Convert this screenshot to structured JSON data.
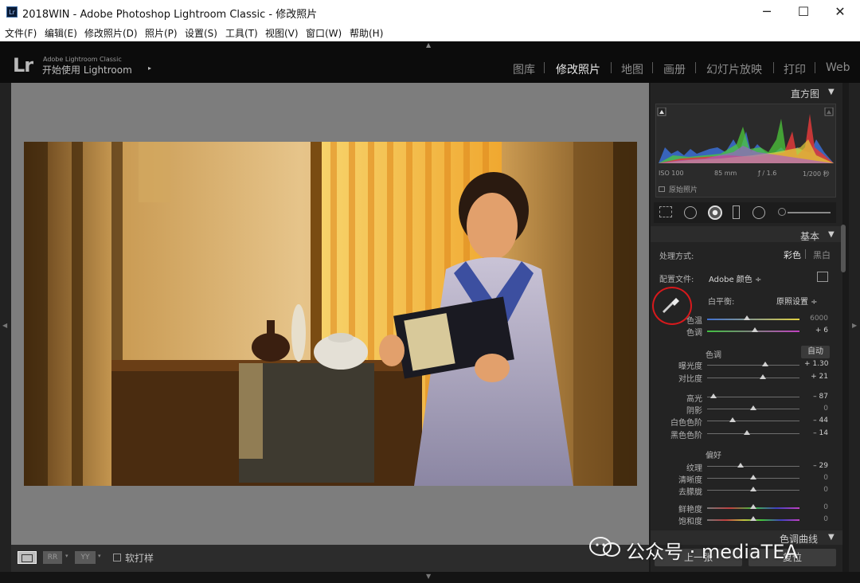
{
  "window": {
    "title": "2018WIN - Adobe Photoshop Lightroom Classic - 修改照片",
    "app_icon_text": "Lr",
    "minimize_icon": "minimize-icon",
    "maximize_icon": "maximize-icon",
    "close_icon": "close-icon"
  },
  "menubar": {
    "items": [
      "文件(F)",
      "编辑(E)",
      "修改照片(D)",
      "照片(P)",
      "设置(S)",
      "工具(T)",
      "视图(V)",
      "窗口(W)",
      "帮助(H)"
    ]
  },
  "header": {
    "logo": "Lr",
    "brand_small": "Adobe Lightroom Classic",
    "brand_large": "开始使用 Lightroom",
    "brand_arrow": "▸",
    "modules": [
      "图库",
      "修改照片",
      "地图",
      "画册",
      "幻灯片放映",
      "打印",
      "Web"
    ],
    "active_module": "修改照片"
  },
  "histogram": {
    "title": "直方图",
    "iso": "ISO 100",
    "focal": "85 mm",
    "aperture": "ƒ / 1.6",
    "shutter": "1/200 秒",
    "original_photo_label": "原始照片"
  },
  "basic": {
    "title": "基本",
    "treatment_label": "处理方式:",
    "color_option": "彩色",
    "bw_option": "黑白",
    "profile_label": "配置文件:",
    "profile_value": "Adobe 颜色 ÷",
    "wb_label": "白平衡:",
    "wb_value": "原照设置 ÷",
    "temp_label": "色温",
    "temp_value": "6000",
    "tint_label": "色调",
    "tint_value": "+ 6",
    "tone_title": "色调",
    "auto_label": "自动",
    "exposure_label": "曝光度",
    "exposure_value": "+ 1.30",
    "contrast_label": "对比度",
    "contrast_value": "+ 21",
    "highlights_label": "高光",
    "highlights_value": "– 87",
    "shadows_label": "阴影",
    "shadows_value": "0",
    "whites_label": "白色色阶",
    "whites_value": "– 44",
    "blacks_label": "黑色色阶",
    "blacks_value": "– 14",
    "presence_title": "偏好",
    "texture_label": "纹理",
    "texture_value": "– 29",
    "clarity_label": "清晰度",
    "clarity_value": "0",
    "dehaze_label": "去朦胧",
    "dehaze_value": "0",
    "vibrance_label": "鲜艳度",
    "vibrance_value": "0",
    "saturation_label": "饱和度",
    "saturation_value": "0"
  },
  "slider_levels": {
    "temp": 0.43,
    "tint": 0.52,
    "exposure": 0.63,
    "contrast": 0.6,
    "highlights": 0.07,
    "shadows": 0.5,
    "whites": 0.28,
    "blacks": 0.43,
    "texture": 0.36,
    "clarity": 0.5,
    "dehaze": 0.5,
    "vibrance": 0.5,
    "saturation": 0.5
  },
  "tone_curve": {
    "title": "色调曲线"
  },
  "bottom": {
    "soft_proof_label": "软打样",
    "previous_label": "上一张",
    "reset_label": "复位"
  },
  "watermark": "公众号 · mediaTEA",
  "colors": {
    "highlight_ring": "#d7191c",
    "panel_bg": "#232323",
    "photo_bg": "#7d7d7d"
  }
}
